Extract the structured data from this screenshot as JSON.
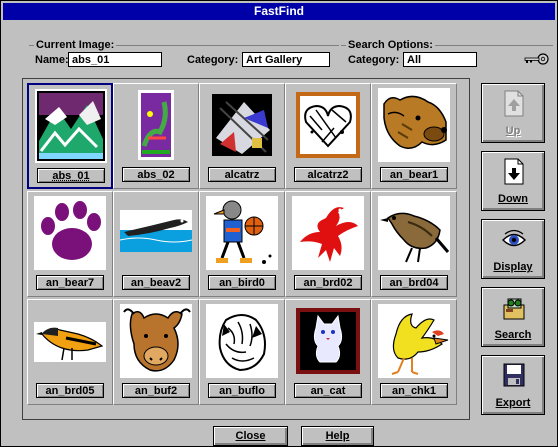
{
  "window": {
    "title": "FastFind"
  },
  "current_image": {
    "group_label": "Current Image:",
    "name_label": "Name:",
    "name_value": "abs_01",
    "category_label": "Category:",
    "category_value": "Art Gallery"
  },
  "search_options": {
    "group_label": "Search Options:",
    "category_label": "Category:",
    "category_value": "All",
    "key_icon": "key-icon"
  },
  "gallery": {
    "items": [
      {
        "label": "abs_01",
        "icon": "abstract-mountain-thumbnail",
        "selected": true
      },
      {
        "label": "abs_02",
        "icon": "abstract-lizard-thumbnail"
      },
      {
        "label": "alcatrz",
        "icon": "alcatraz-abstract-thumbnail"
      },
      {
        "label": "alcatrz2",
        "icon": "alcatraz-heart-thumbnail"
      },
      {
        "label": "an_bear1",
        "icon": "bear-head-thumbnail"
      },
      {
        "label": "an_bear7",
        "icon": "paw-print-thumbnail"
      },
      {
        "label": "an_beav2",
        "icon": "beaver-swimming-thumbnail"
      },
      {
        "label": "an_bird0",
        "icon": "bird-basketball-thumbnail"
      },
      {
        "label": "an_brd02",
        "icon": "red-bird-thumbnail"
      },
      {
        "label": "an_brd04",
        "icon": "sparrow-thumbnail"
      },
      {
        "label": "an_brd05",
        "icon": "oriole-thumbnail"
      },
      {
        "label": "an_buf2",
        "icon": "buffalo-head-thumbnail"
      },
      {
        "label": "an_buflo",
        "icon": "buffalo-sketch-thumbnail"
      },
      {
        "label": "an_cat",
        "icon": "cat-thumbnail"
      },
      {
        "label": "an_chk1",
        "icon": "chicken-thumbnail"
      }
    ]
  },
  "toolbar": {
    "up": {
      "label": "Up",
      "icon": "page-up-icon",
      "disabled": true
    },
    "down": {
      "label": "Down",
      "icon": "page-down-icon"
    },
    "display": {
      "label": "Display",
      "icon": "eye-icon"
    },
    "search": {
      "label": "Search",
      "icon": "search-binoculars-icon"
    },
    "export": {
      "label": "Export",
      "icon": "floppy-disk-icon"
    }
  },
  "footer": {
    "close_label": "Close",
    "help_label": "Help"
  },
  "colors": {
    "title_bar": "#0000a8",
    "face": "#c0c0c0",
    "selection": "#000080"
  }
}
